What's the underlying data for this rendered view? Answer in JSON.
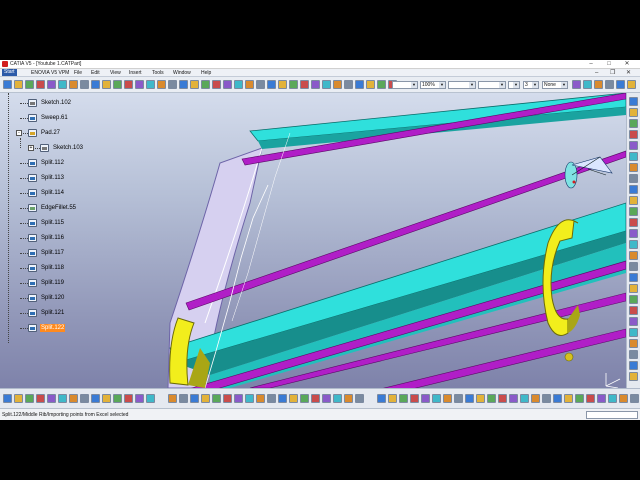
{
  "window": {
    "title": "CATIA V5 - [Youtube 1.CATPart]",
    "minimize": "–",
    "maximize": "□",
    "close": "✕"
  },
  "menu": {
    "items": [
      "Start",
      "ENOVIA V5 VPM",
      "File",
      "Edit",
      "View",
      "Insert",
      "Tools",
      "Window",
      "Help"
    ],
    "mdi_minimize": "–",
    "mdi_restore": "❐",
    "mdi_close": "✕"
  },
  "toolbar": {
    "zoom_value": "100%",
    "layer_value": "3",
    "display_value": "None"
  },
  "tree": {
    "nodes": [
      {
        "label": "Sketch.102",
        "icon": "sketch-icon",
        "level": 1
      },
      {
        "label": "Sweep.61",
        "icon": "sweep-icon",
        "level": 1
      },
      {
        "label": "Pad.27",
        "icon": "pad-icon",
        "level": 1,
        "expander": "-"
      },
      {
        "label": "Sketch.103",
        "icon": "sketch-icon",
        "level": 2,
        "expander": "+"
      },
      {
        "label": "Split.112",
        "icon": "split-icon",
        "level": 1
      },
      {
        "label": "Split.113",
        "icon": "split-icon",
        "level": 1
      },
      {
        "label": "Split.114",
        "icon": "split-icon",
        "level": 1
      },
      {
        "label": "EdgeFillet.55",
        "icon": "edge-fillet-icon",
        "level": 1
      },
      {
        "label": "Split.115",
        "icon": "split-icon",
        "level": 1
      },
      {
        "label": "Split.116",
        "icon": "split-icon",
        "level": 1
      },
      {
        "label": "Split.117",
        "icon": "split-icon",
        "level": 1
      },
      {
        "label": "Split.118",
        "icon": "split-icon",
        "level": 1
      },
      {
        "label": "Split.119",
        "icon": "split-icon",
        "level": 1
      },
      {
        "label": "Split.120",
        "icon": "split-icon",
        "level": 1
      },
      {
        "label": "Split.121",
        "icon": "split-icon",
        "level": 1
      },
      {
        "label": "Split.122",
        "icon": "split-icon",
        "level": 1,
        "selected": true
      }
    ]
  },
  "status": {
    "text": "Split.122/Middle Rib/Importing points from Excel selected"
  },
  "colors": {
    "selection": "#ff8a1e",
    "cyan_surface": "#2fe0dc",
    "purple_rib": "#b01ec7",
    "yellow_part": "#f2ee1c",
    "lavender_plate": "#d6d0f0"
  }
}
